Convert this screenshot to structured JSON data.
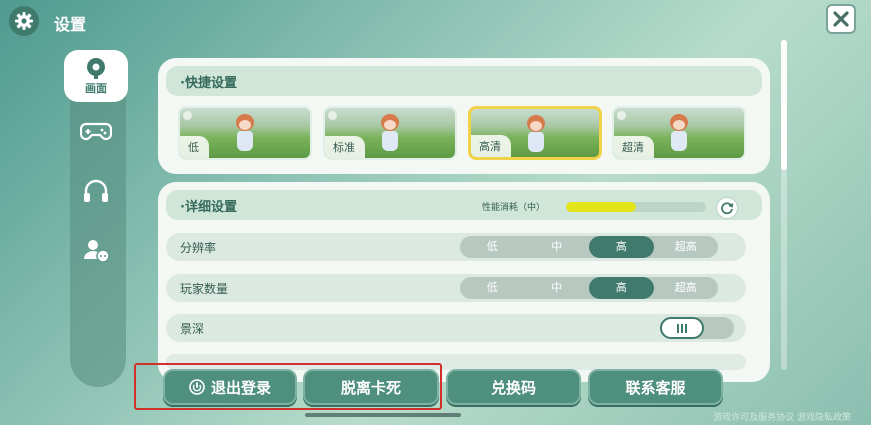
{
  "header": {
    "title": "设置",
    "settings_icon": "gear-icon",
    "close_icon": "close-icon"
  },
  "sidebar": {
    "items": [
      {
        "icon": "display-icon",
        "label": "画面",
        "active": true
      },
      {
        "icon": "gamepad-icon",
        "label": "",
        "active": false
      },
      {
        "icon": "headphones-icon",
        "label": "",
        "active": false
      },
      {
        "icon": "social-icon",
        "label": "",
        "active": false
      }
    ]
  },
  "quick_settings": {
    "title": "·快捷设置",
    "presets": [
      {
        "label": "低",
        "selected": false
      },
      {
        "label": "标准",
        "selected": false
      },
      {
        "label": "高清",
        "selected": true
      },
      {
        "label": "超清",
        "selected": false
      }
    ]
  },
  "detail_settings": {
    "title": "·详细设置",
    "performance_label": "性能消耗（中）",
    "performance_level": 0.5,
    "rows": [
      {
        "label": "分辨率",
        "options": [
          "低",
          "中",
          "高",
          "超高"
        ],
        "selected": "高"
      },
      {
        "label": "玩家数量",
        "options": [
          "低",
          "中",
          "高",
          "超高"
        ],
        "selected": "高"
      },
      {
        "label": "景深",
        "toggle": "on"
      }
    ]
  },
  "bottom_buttons": {
    "logout": "退出登录",
    "unstuck": "脱离卡死",
    "redeem": "兑换码",
    "support": "联系客服"
  },
  "footer": {
    "links": "游戏许可及服务协议 游戏隐私政策"
  },
  "colors": {
    "accent": "#3f7a6c",
    "highlight": "#f1d34a",
    "annotation": "#d0322b"
  }
}
